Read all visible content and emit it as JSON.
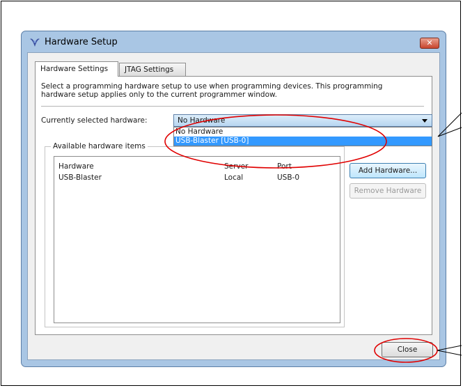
{
  "window": {
    "title": "Hardware Setup",
    "close_glyph": "✕"
  },
  "tabs": [
    {
      "label": "Hardware Settings"
    },
    {
      "label": "JTAG Settings"
    }
  ],
  "description": "Select a programming hardware setup to use when programming devices. This programming hardware setup applies only to the current programmer window.",
  "current_hardware": {
    "label": "Currently selected hardware:",
    "value": "No Hardware",
    "options": [
      "No Hardware",
      "USB-Blaster [USB-0]"
    ]
  },
  "available": {
    "group_label": "Available hardware items",
    "columns": [
      "Hardware",
      "Server",
      "Port"
    ],
    "rows": [
      {
        "hardware": "USB-Blaster",
        "server": "Local",
        "port": "USB-0"
      }
    ]
  },
  "buttons": {
    "add": "Add Hardware...",
    "remove": "Remove Hardware",
    "close": "Close"
  },
  "colors": {
    "annotation": "#e00000",
    "selection": "#3399ff"
  }
}
